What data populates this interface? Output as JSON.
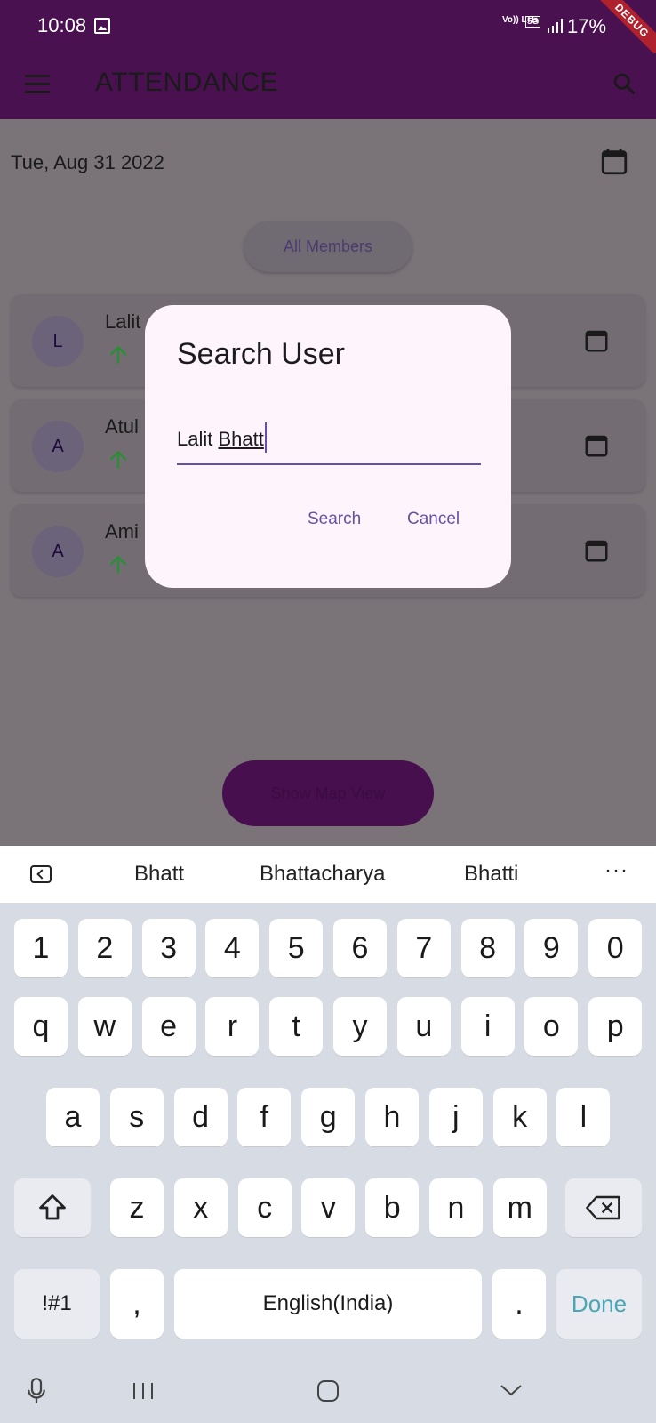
{
  "status_bar": {
    "time": "10:08",
    "network": "Vo)) LTE",
    "network_5g": "5G",
    "battery": "17%",
    "debug_banner": "DEBUG"
  },
  "app_bar": {
    "title": "ATTENDANCE"
  },
  "page": {
    "date": "Tue, Aug 31 2022",
    "filter_button": "All Members",
    "members": [
      {
        "initial": "L",
        "name": "Lalit"
      },
      {
        "initial": "A",
        "name": "Atul"
      },
      {
        "initial": "A",
        "name": "Ami"
      }
    ],
    "fab_label": "Show Map View"
  },
  "dialog": {
    "title": "Search User",
    "input_value_first": "Lalit ",
    "input_value_composing": "Bhatt",
    "search_label": "Search",
    "cancel_label": "Cancel"
  },
  "keyboard": {
    "suggestions": [
      "Bhatt",
      "Bhattacharya",
      "Bhatti"
    ],
    "more": "···",
    "row_numbers": [
      "1",
      "2",
      "3",
      "4",
      "5",
      "6",
      "7",
      "8",
      "9",
      "0"
    ],
    "row_top": [
      "q",
      "w",
      "e",
      "r",
      "t",
      "y",
      "u",
      "i",
      "o",
      "p"
    ],
    "row_mid": [
      "a",
      "s",
      "d",
      "f",
      "g",
      "h",
      "j",
      "k",
      "l"
    ],
    "row_bottom": [
      "z",
      "x",
      "c",
      "v",
      "b",
      "n",
      "m"
    ],
    "symbols": "!#1",
    "comma": ",",
    "space": "English(India)",
    "period": ".",
    "done": "Done"
  },
  "colors": {
    "app_bar": "#4a1150",
    "accent": "#6750a4",
    "arrow_up": "#2e8b3a",
    "done_key": "#4aa6b5"
  }
}
